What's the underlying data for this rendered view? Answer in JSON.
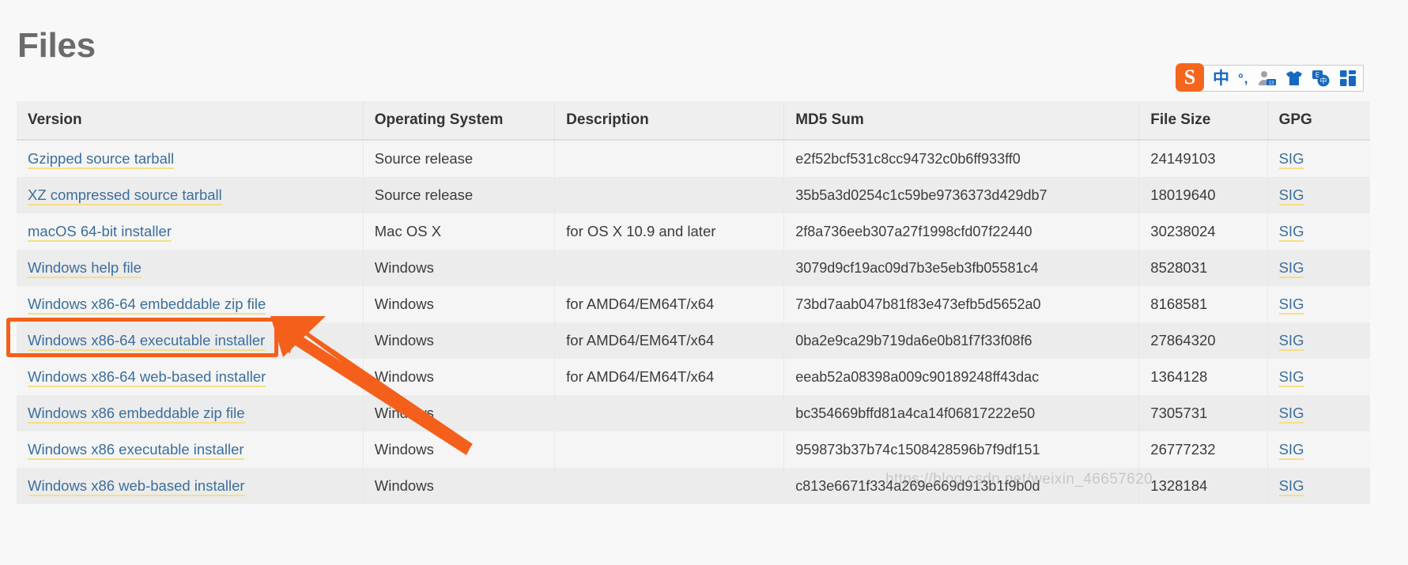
{
  "page": {
    "title": "Files",
    "watermark": "https://blog.csdn.net/weixin_46657620"
  },
  "ime_toolbar": {
    "logo_label": "S",
    "items": [
      {
        "name": "sogou-logo-icon",
        "glyph": "S"
      },
      {
        "name": "chinese-mode-icon",
        "glyph": "中"
      },
      {
        "name": "punctuation-mode-icon",
        "glyph": "°,"
      },
      {
        "name": "user-id-icon",
        "glyph": ""
      },
      {
        "name": "skin-shirt-icon",
        "glyph": ""
      },
      {
        "name": "translate-icon",
        "glyph": ""
      },
      {
        "name": "toolbox-grid-icon",
        "glyph": ""
      }
    ]
  },
  "table": {
    "columns": [
      "Version",
      "Operating System",
      "Description",
      "MD5 Sum",
      "File Size",
      "GPG"
    ],
    "gpg_label": "SIG",
    "rows": [
      {
        "version": "Gzipped source tarball",
        "os": "Source release",
        "description": "",
        "md5": "e2f52bcf531c8cc94732c0b6ff933ff0",
        "size": "24149103",
        "gpg": "SIG"
      },
      {
        "version": "XZ compressed source tarball",
        "os": "Source release",
        "description": "",
        "md5": "35b5a3d0254c1c59be9736373d429db7",
        "size": "18019640",
        "gpg": "SIG"
      },
      {
        "version": "macOS 64-bit installer",
        "os": "Mac OS X",
        "description": "for OS X 10.9 and later",
        "md5": "2f8a736eeb307a27f1998cfd07f22440",
        "size": "30238024",
        "gpg": "SIG"
      },
      {
        "version": "Windows help file",
        "os": "Windows",
        "description": "",
        "md5": "3079d9cf19ac09d7b3e5eb3fb05581c4",
        "size": "8528031",
        "gpg": "SIG"
      },
      {
        "version": "Windows x86-64 embeddable zip file",
        "os": "Windows",
        "description": "for AMD64/EM64T/x64",
        "md5": "73bd7aab047b81f83e473efb5d5652a0",
        "size": "8168581",
        "gpg": "SIG"
      },
      {
        "version": "Windows x86-64 executable installer",
        "os": "Windows",
        "description": "for AMD64/EM64T/x64",
        "md5": "0ba2e9ca29b719da6e0b81f7f33f08f6",
        "size": "27864320",
        "gpg": "SIG"
      },
      {
        "version": "Windows x86-64 web-based installer",
        "os": "Windows",
        "description": "for AMD64/EM64T/x64",
        "md5": "eeab52a08398a009c90189248ff43dac",
        "size": "1364128",
        "gpg": "SIG"
      },
      {
        "version": "Windows x86 embeddable zip file",
        "os": "Windows",
        "description": "",
        "md5": "bc354669bffd81a4ca14f06817222e50",
        "size": "7305731",
        "gpg": "SIG"
      },
      {
        "version": "Windows x86 executable installer",
        "os": "Windows",
        "description": "",
        "md5": "959873b37b74c1508428596b7f9df151",
        "size": "26777232",
        "gpg": "SIG"
      },
      {
        "version": "Windows x86 web-based installer",
        "os": "Windows",
        "description": "",
        "md5": "c813e6671f334a269e669d913b1f9b0d",
        "size": "1328184",
        "gpg": "SIG"
      }
    ]
  },
  "annotation": {
    "highlight_row_index": 5,
    "box_color": "#f4601b",
    "arrow_color": "#f4601b"
  },
  "colors": {
    "link": "#3b6e9e",
    "link_underline": "#f5df84",
    "accent_orange": "#f4601b",
    "header_bg": "#efefef",
    "row_odd": "#f5f5f5",
    "row_even": "#ececec",
    "title": "#6b6b6b"
  }
}
